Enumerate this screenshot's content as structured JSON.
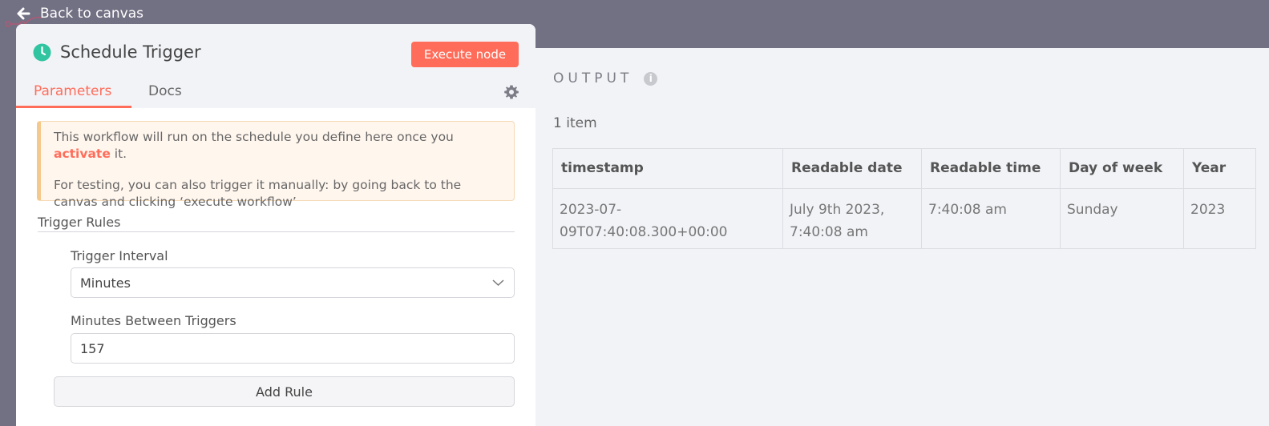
{
  "nav": {
    "back_label": "Back to canvas"
  },
  "node": {
    "title": "Schedule Trigger",
    "execute_label": "Execute node",
    "icon": "clock-icon",
    "accent": "#ff6d5a"
  },
  "tabs": [
    {
      "label": "Parameters",
      "active": true
    },
    {
      "label": "Docs",
      "active": false
    }
  ],
  "notice": {
    "line1_before": "This workflow will run on the schedule you define here once you ",
    "line1_link": "activate",
    "line1_after": " it.",
    "line2": "For testing, you can also trigger it manually: by going back to the canvas and clicking ‘execute workflow’"
  },
  "rules": {
    "section_title": "Trigger Rules",
    "interval_label": "Trigger Interval",
    "interval_value": "Minutes",
    "minutes_label": "Minutes Between Triggers",
    "minutes_value": "157",
    "add_rule_label": "Add Rule"
  },
  "output": {
    "title": "OUTPUT",
    "item_count": "1 item",
    "columns": [
      "timestamp",
      "Readable date",
      "Readable time",
      "Day of week",
      "Year"
    ],
    "rows": [
      [
        "2023-07-09T07:40:08.300+00:00",
        "July 9th 2023, 7:40:08 am",
        "7:40:08 am",
        "Sunday",
        "2023"
      ]
    ]
  }
}
